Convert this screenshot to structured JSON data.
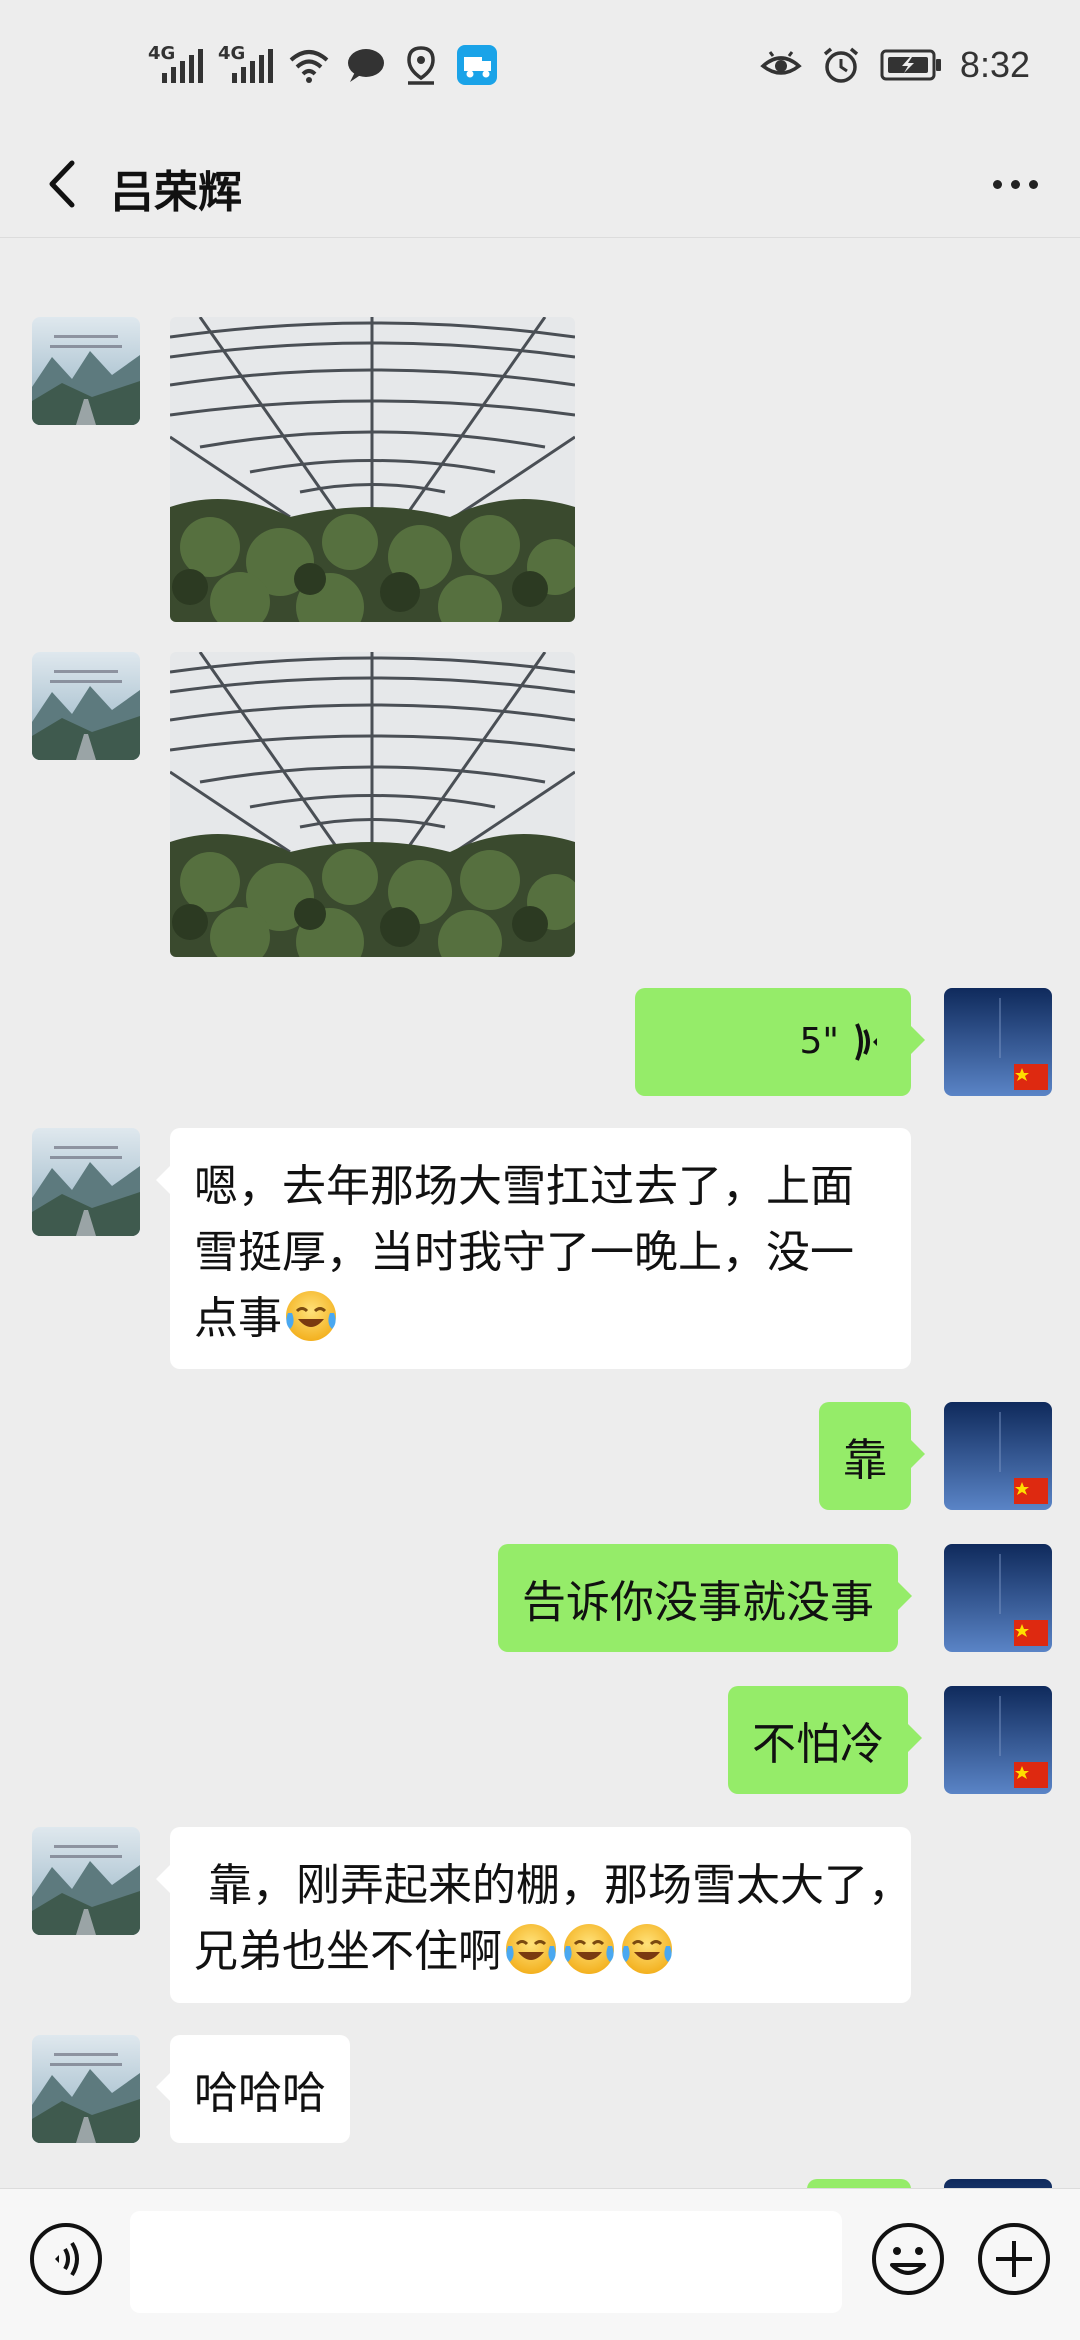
{
  "status_bar": {
    "network1": "4G",
    "network2": "4G",
    "time": "8:32",
    "icons": [
      "signal-icon",
      "signal-icon",
      "wifi-icon",
      "message-icon",
      "location-icon",
      "app-icon",
      "eye-icon",
      "alarm-icon",
      "battery-icon"
    ]
  },
  "header": {
    "title": "吕荣辉",
    "back_icon": "chevron-left-icon",
    "more_icon": "more-dots-icon"
  },
  "messages": [
    {
      "from": "other",
      "type": "image"
    },
    {
      "from": "other",
      "type": "image"
    },
    {
      "from": "other",
      "type": "image"
    },
    {
      "from": "me",
      "type": "voice",
      "duration": "5\""
    },
    {
      "from": "other",
      "type": "text",
      "lines": [
        "嗯，去年那场大雪扛过去了，上面",
        "雪挺厚，当时我守了一晚上，没一",
        "点事"
      ],
      "emoji": [
        "crying-laughing-emoji"
      ]
    },
    {
      "from": "me",
      "type": "text",
      "text": "靠"
    },
    {
      "from": "me",
      "type": "text",
      "text": "告诉你没事就没事"
    },
    {
      "from": "me",
      "type": "text",
      "text": "不怕冷"
    },
    {
      "from": "other",
      "type": "text",
      "lines": [
        " 靠，刚弄起来的棚，那场雪太大了，",
        "兄弟也坐不住啊"
      ],
      "emoji": [
        "crying-laughing-emoji",
        "crying-laughing-emoji",
        "crying-laughing-emoji"
      ]
    },
    {
      "from": "other",
      "type": "text",
      "text": "哈哈哈"
    },
    {
      "from": "me",
      "type": "text",
      "text": ""
    }
  ],
  "input_bar": {
    "placeholder": "",
    "voice_icon": "voice-input-icon",
    "emoji_icon": "emoji-icon",
    "plus_icon": "plus-icon"
  },
  "colors": {
    "background": "#ededed",
    "bubble_out": "#95ec69",
    "bubble_in": "#ffffff"
  }
}
